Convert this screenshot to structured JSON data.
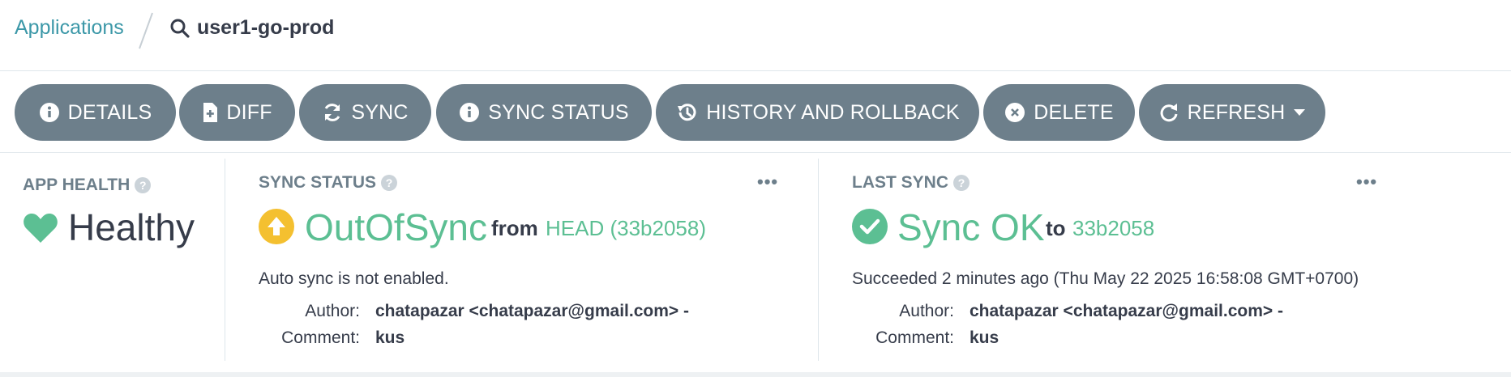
{
  "breadcrumb": {
    "root": "Applications",
    "current": "user1-go-prod"
  },
  "toolbar": {
    "buttons": [
      {
        "label": "DETAILS"
      },
      {
        "label": "DIFF"
      },
      {
        "label": "SYNC"
      },
      {
        "label": "SYNC STATUS"
      },
      {
        "label": "HISTORY AND ROLLBACK"
      },
      {
        "label": "DELETE"
      },
      {
        "label": "REFRESH"
      }
    ]
  },
  "app_health": {
    "label": "APP HEALTH",
    "status": "Healthy"
  },
  "sync_status": {
    "label": "SYNC STATUS",
    "status": "OutOfSync",
    "from_word": "from",
    "revision": "HEAD (33b2058)",
    "auto_sync_text": "Auto sync is not enabled.",
    "author_key": "Author:",
    "author_value": "chatapazar <chatapazar@gmail.com> -",
    "comment_key": "Comment:",
    "comment_value": "kus",
    "menu": "•••"
  },
  "last_sync": {
    "label": "LAST SYNC",
    "status": "Sync OK",
    "to_word": "to",
    "revision": "33b2058",
    "result_text": "Succeeded 2 minutes ago (Thu May 22 2025 16:58:08 GMT+0700)",
    "author_key": "Author:",
    "author_value": "chatapazar <chatapazar@gmail.com> -",
    "comment_key": "Comment:",
    "comment_value": "kus",
    "menu": "•••"
  },
  "colors": {
    "link": "#3c98a8",
    "button_bg": "#6d7f8b",
    "healthy_green": "#5cbf93",
    "outofsync_yellow": "#f4c030",
    "text_dark": "#363c4a"
  }
}
